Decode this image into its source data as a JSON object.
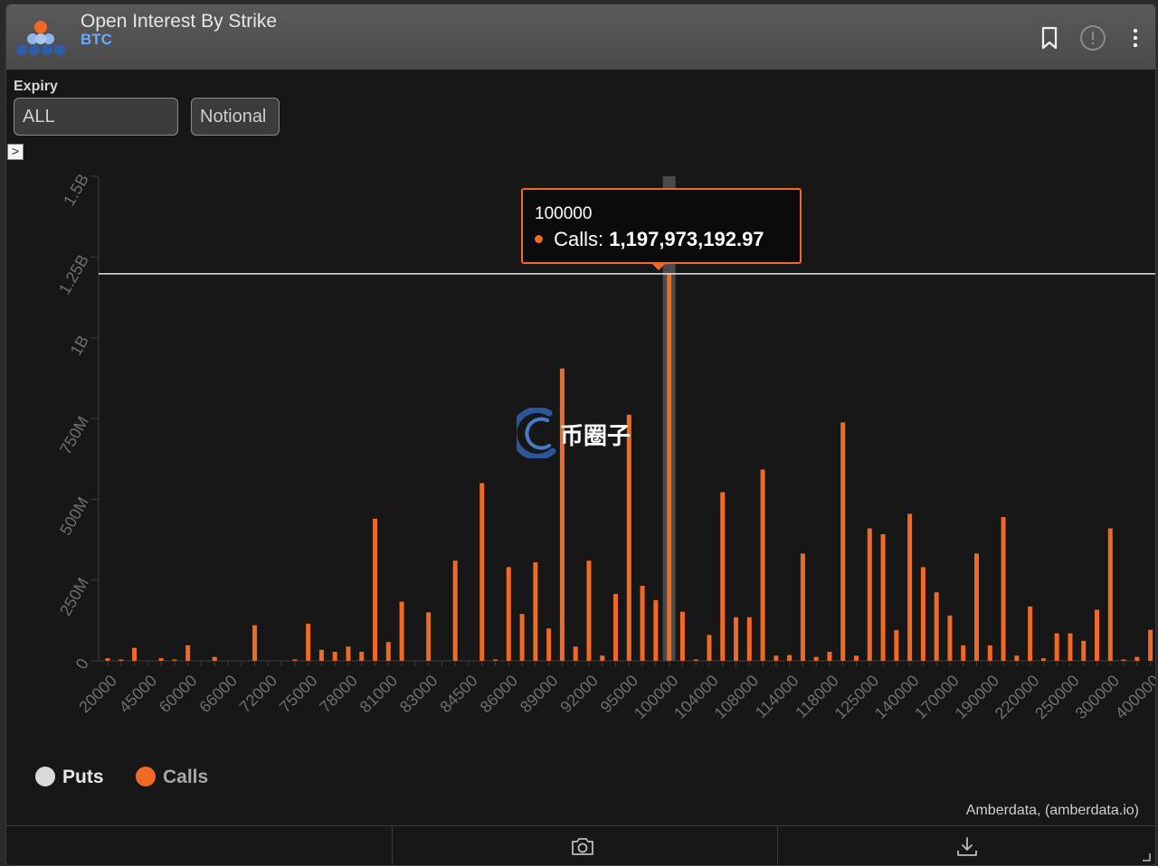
{
  "header": {
    "title": "Open Interest By Strike",
    "subtitle": "BTC",
    "icons": [
      "bookmark-icon",
      "info-icon",
      "more-icon"
    ]
  },
  "controls": {
    "expiry_label": "Expiry",
    "expiry_value": "ALL",
    "notional_label": "Notional",
    "toggle_glyph": ">"
  },
  "tooltip": {
    "x": "100000",
    "series": "Calls:",
    "value": "1,197,973,192.97"
  },
  "watermark_text": "币圈子",
  "credit": "Amberdata, (amberdata.io)",
  "colors": {
    "calls": "#f06a25",
    "puts": "#d9d9d9",
    "accent": "#6aa8ff"
  },
  "chart_data": {
    "type": "bar",
    "ylim": [
      0,
      1500000000
    ],
    "y_ticks": [
      {
        "value": 0,
        "label": "0"
      },
      {
        "value": 250000000,
        "label": "250M"
      },
      {
        "value": 500000000,
        "label": "500M"
      },
      {
        "value": 750000000,
        "label": "750M"
      },
      {
        "value": 1000000000,
        "label": "1B"
      },
      {
        "value": 1250000000,
        "label": "1.25B"
      },
      {
        "value": 1500000000,
        "label": "1.5B"
      }
    ],
    "x_tick_labels": [
      {
        "index": 0,
        "label": "20000"
      },
      {
        "index": 3,
        "label": "45000"
      },
      {
        "index": 6,
        "label": "60000"
      },
      {
        "index": 9,
        "label": "66000"
      },
      {
        "index": 12,
        "label": "72000"
      },
      {
        "index": 15,
        "label": "75000"
      },
      {
        "index": 18,
        "label": "78000"
      },
      {
        "index": 21,
        "label": "81000"
      },
      {
        "index": 24,
        "label": "83000"
      },
      {
        "index": 27,
        "label": "84500"
      },
      {
        "index": 30,
        "label": "86000"
      },
      {
        "index": 33,
        "label": "89000"
      },
      {
        "index": 36,
        "label": "92000"
      },
      {
        "index": 39,
        "label": "95000"
      },
      {
        "index": 42,
        "label": "100000"
      },
      {
        "index": 45,
        "label": "104000"
      },
      {
        "index": 48,
        "label": "108000"
      },
      {
        "index": 51,
        "label": "114000"
      },
      {
        "index": 54,
        "label": "118000"
      },
      {
        "index": 57,
        "label": "125000"
      },
      {
        "index": 60,
        "label": "140000"
      },
      {
        "index": 63,
        "label": "170000"
      },
      {
        "index": 66,
        "label": "190000"
      },
      {
        "index": 69,
        "label": "220000"
      },
      {
        "index": 72,
        "label": "250000"
      },
      {
        "index": 75,
        "label": "300000"
      },
      {
        "index": 78,
        "label": "400000"
      }
    ],
    "highlight_index": 42,
    "reference_line_value": 1197973192.97,
    "series": [
      {
        "name": "Puts",
        "values": []
      },
      {
        "name": "Calls",
        "values": [
          8000000,
          4000000,
          40000000,
          0,
          8000000,
          4000000,
          48000000,
          0,
          12000000,
          0,
          0,
          110000000,
          0,
          0,
          4000000,
          115000000,
          34000000,
          28000000,
          44000000,
          28000000,
          440000000,
          58000000,
          183000000,
          0,
          150000000,
          0,
          310000000,
          0,
          550000000,
          4000000,
          290000000,
          145000000,
          305000000,
          100000000,
          905000000,
          44000000,
          310000000,
          16000000,
          207000000,
          762000000,
          232000000,
          188000000,
          1197973192.97,
          152000000,
          4000000,
          80000000,
          522000000,
          135000000,
          135000000,
          592000000,
          16000000,
          18000000,
          332000000,
          12000000,
          28000000,
          738000000,
          16000000,
          410000000,
          392000000,
          95000000,
          455000000,
          290000000,
          212000000,
          140000000,
          48000000,
          332000000,
          48000000,
          445000000,
          16000000,
          168000000,
          8000000,
          85000000,
          85000000,
          62000000,
          158000000,
          410000000,
          4000000,
          12000000,
          96000000
        ]
      }
    ]
  }
}
